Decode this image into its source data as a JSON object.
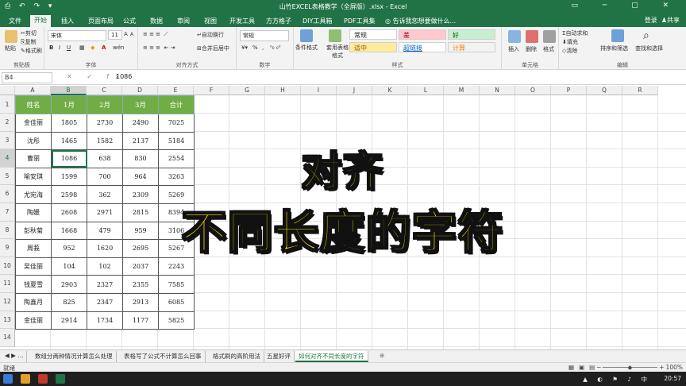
{
  "titlebar": {
    "title": "山竹EXCEL表格教学（全屏版）.xlsx - Excel",
    "quick_access": "⎙ ↶ ↷ ▾",
    "window_controls": "▭ ─ ▢ ✕"
  },
  "tabs": [
    "文件",
    "开始",
    "插入",
    "页面布局",
    "公式",
    "数据",
    "审阅",
    "视图",
    "开发工具",
    "方方格子",
    "DIY工具箱",
    "PDF工具集"
  ],
  "tell_me": "告诉我您想要做什么...",
  "signin": "登录",
  "share": "共享",
  "ribbon": {
    "clipboard": {
      "paste": "粘贴",
      "cut": "剪切",
      "copy": "复制",
      "format_painter": "格式刷",
      "label": "剪贴板"
    },
    "font": {
      "name": "宋体",
      "size": "11",
      "grow": "A",
      "shrink": "A",
      "bold": "B",
      "italic": "I",
      "underline": "U",
      "wen": "wén",
      "label": "字体"
    },
    "alignment": {
      "wrap": "自动换行",
      "merge": "合并后居中",
      "label": "对齐方式"
    },
    "number": {
      "format": "常规",
      "percent": "%",
      "comma": ",",
      "label": "数字"
    },
    "styles": {
      "conditional": "条件格式",
      "table": "套用表格格式",
      "normal": "常规",
      "bad": "差",
      "good": "好",
      "neutral": "适中",
      "hyperlink": "超链接",
      "calc": "计算",
      "label": "样式"
    },
    "cells": {
      "insert": "插入",
      "delete": "删除",
      "format": "格式",
      "label": "单元格"
    },
    "editing": {
      "autosum": "自动求和",
      "fill": "填充",
      "clear": "清除",
      "sort": "排序和筛选",
      "find": "查找和选择",
      "label": "编辑"
    }
  },
  "formula_bar": {
    "name_box": "B4",
    "fx_symbols": "✕ ✓ fx",
    "value": "1086"
  },
  "columns": [
    "A",
    "B",
    "C",
    "D",
    "E",
    "F",
    "G",
    "H",
    "I",
    "J",
    "K",
    "L",
    "M",
    "N",
    "O",
    "P",
    "Q",
    "R"
  ],
  "rows": [
    "1",
    "2",
    "3",
    "4",
    "5",
    "6",
    "7",
    "8",
    "9",
    "10",
    "11",
    "12",
    "13",
    "14"
  ],
  "table": {
    "headers": [
      "姓名",
      "1月",
      "2月",
      "3月",
      "合计"
    ],
    "rows": [
      [
        "金佳丽",
        "1805",
        "2730",
        "2490",
        "7025"
      ],
      [
        "沈彤",
        "1465",
        "1582",
        "2137",
        "5184"
      ],
      [
        "曹丽",
        "1086",
        "638",
        "830",
        "2554"
      ],
      [
        "喻安琪",
        "1599",
        "700",
        "964",
        "3263"
      ],
      [
        "尤宛海",
        "2598",
        "362",
        "2309",
        "5269"
      ],
      [
        "陶媛",
        "2608",
        "2971",
        "2815",
        "8394"
      ],
      [
        "彭秋菊",
        "1668",
        "479",
        "959",
        "3106"
      ],
      [
        "周莪",
        "952",
        "1620",
        "2695",
        "5267"
      ],
      [
        "吴佳丽",
        "104",
        "102",
        "2037",
        "2243"
      ],
      [
        "钱夏雪",
        "2903",
        "2327",
        "2355",
        "7585"
      ],
      [
        "陶鑫月",
        "825",
        "2347",
        "2913",
        "6085"
      ],
      [
        "金佳丽",
        "2914",
        "1734",
        "1177",
        "5825"
      ]
    ]
  },
  "overlay": {
    "line1": "对齐",
    "line2": "不同长度的字符"
  },
  "sheet_tabs": [
    "数组分两种情况计算怎么处理",
    "表格写了公式不计算怎么回事",
    "格式刷的高阶用法",
    "五星好评",
    "如何对齐不同长度的字符"
  ],
  "sheet_nav": "◀ ▶ ...",
  "add_sheet": "⊕",
  "status": {
    "ready": "就绪",
    "zoom": "100%"
  },
  "taskbar": {
    "time": "20:57"
  },
  "colors": {
    "excel_green": "#217346",
    "header_green": "#70ad47",
    "overlay_yellow": "#ffe600"
  }
}
